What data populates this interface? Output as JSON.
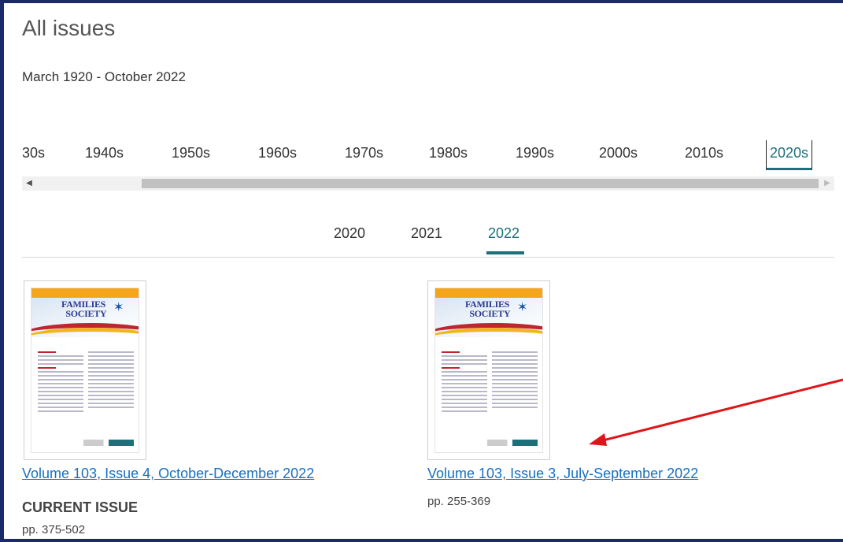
{
  "page": {
    "title": "All issues",
    "date_range": "March 1920 - October 2022"
  },
  "decades": [
    "30s",
    "1940s",
    "1950s",
    "1960s",
    "1970s",
    "1980s",
    "1990s",
    "2000s",
    "2010s",
    "2020s"
  ],
  "selected_decade": "2020s",
  "years": [
    "2020",
    "2021",
    "2022"
  ],
  "selected_year": "2022",
  "issues": [
    {
      "title": "Volume 103, Issue 4, October-December 2022",
      "badge": "CURRENT ISSUE",
      "pages": "pp. 375-502"
    },
    {
      "title": "Volume 103, Issue 3, July-September 2022",
      "pages": "pp. 255-369"
    }
  ],
  "colors": {
    "accent": "#1d6f7a",
    "link": "#1a6fbf",
    "frame": "#1b2a6b",
    "annotation_arrow": "#e0151a"
  }
}
